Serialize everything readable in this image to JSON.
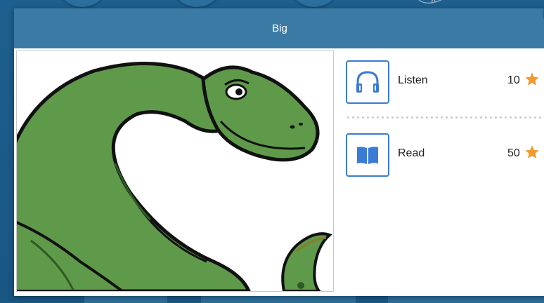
{
  "modal": {
    "title": "Big",
    "image_alt": "green dinosaur"
  },
  "activities": [
    {
      "label": "Listen",
      "points": "10",
      "icon": "headphones-icon"
    },
    {
      "label": "Read",
      "points": "50",
      "icon": "book-icon"
    }
  ],
  "colors": {
    "header": "#3c7aa6",
    "backdrop": "#1a5a86",
    "icon_accent": "#3a7bd5",
    "star": "#f29a2e",
    "dinosaur": "#5f9a4a"
  }
}
